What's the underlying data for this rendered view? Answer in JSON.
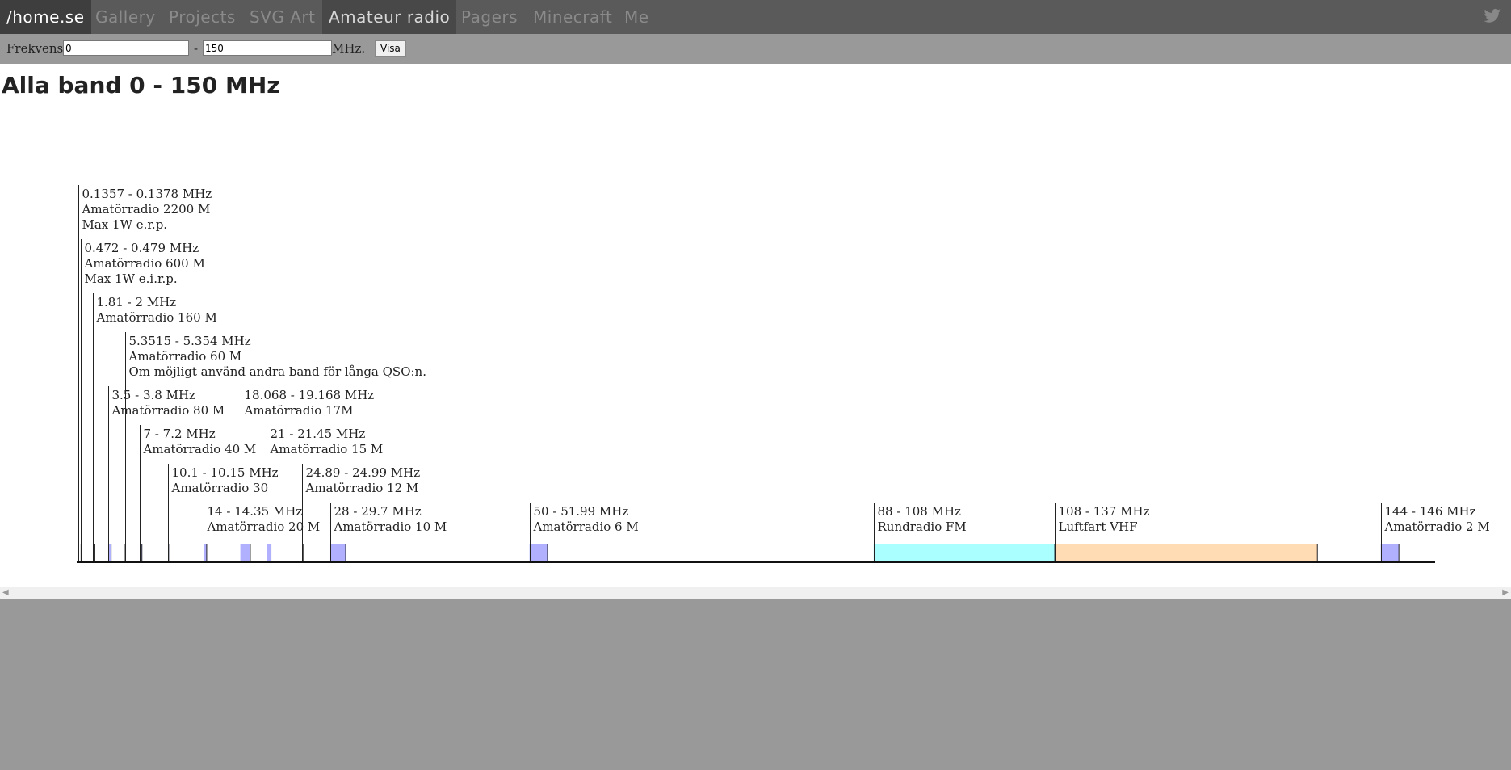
{
  "nav": {
    "home": "/home.se",
    "items": [
      "Gallery",
      "Projects",
      "SVG Art",
      "Amateur radio",
      "Pagers",
      "Minecraft",
      "Me"
    ],
    "active": "Amateur radio",
    "twitter_icon": "twitter-icon"
  },
  "form": {
    "label": "Frekvens:",
    "from_value": "0",
    "dash": "-",
    "to_value": "150",
    "unit": "MHz.",
    "button": "Visa"
  },
  "page": {
    "title": "Alla band 0 - 150 MHz"
  },
  "chart_data": {
    "type": "band-plan",
    "range_mhz": [
      0,
      150
    ],
    "bands": [
      {
        "start": 0.1357,
        "end": 0.1378,
        "lines": [
          "0.1357 - 0.1378 MHz",
          "Amatörradio 2200 M",
          "Max 1W e.r.p."
        ],
        "color": "#b0b0ff"
      },
      {
        "start": 0.472,
        "end": 0.479,
        "lines": [
          "0.472 - 0.479 MHz",
          "Amatörradio 600 M",
          "Max 1W e.i.r.p."
        ],
        "color": "#b0b0ff"
      },
      {
        "start": 1.81,
        "end": 2,
        "lines": [
          "1.81 - 2 MHz",
          "Amatörradio 160 M"
        ],
        "color": "#b0b0ff"
      },
      {
        "start": 3.5,
        "end": 3.8,
        "lines": [
          "3.5 - 3.8 MHz",
          "Amatörradio 80 M"
        ],
        "color": "#b0b0ff"
      },
      {
        "start": 5.3515,
        "end": 5.354,
        "lines": [
          "5.3515 - 5.354 MHz",
          "Amatörradio 60 M",
          "Om möjligt använd andra band för långa QSO:n."
        ],
        "color": "#b0b0ff"
      },
      {
        "start": 7,
        "end": 7.2,
        "lines": [
          "7 - 7.2 MHz",
          "Amatörradio 40 M"
        ],
        "color": "#b0b0ff"
      },
      {
        "start": 10.1,
        "end": 10.15,
        "lines": [
          "10.1 - 10.15 MHz",
          "Amatörradio 30"
        ],
        "color": "#b0b0ff"
      },
      {
        "start": 14,
        "end": 14.35,
        "lines": [
          "14 - 14.35 MHz",
          "Amatörradio 20 M"
        ],
        "color": "#b0b0ff"
      },
      {
        "start": 18.068,
        "end": 19.168,
        "lines": [
          "18.068 - 19.168 MHz",
          "Amatörradio 17M"
        ],
        "color": "#b0b0ff"
      },
      {
        "start": 21,
        "end": 21.45,
        "lines": [
          "21 - 21.45 MHz",
          "Amatörradio 15 M"
        ],
        "color": "#b0b0ff"
      },
      {
        "start": 24.89,
        "end": 24.99,
        "lines": [
          "24.89 - 24.99 MHz",
          "Amatörradio 12 M"
        ],
        "color": "#b0b0ff"
      },
      {
        "start": 28,
        "end": 29.7,
        "lines": [
          "28 - 29.7 MHz",
          "Amatörradio 10 M"
        ],
        "color": "#b0b0ff"
      },
      {
        "start": 50,
        "end": 51.99,
        "lines": [
          "50 - 51.99 MHz",
          "Amatörradio 6 M"
        ],
        "color": "#b0b0ff"
      },
      {
        "start": 88,
        "end": 108,
        "lines": [
          "88 - 108 MHz",
          "Rundradio FM"
        ],
        "color": "#aaffff"
      },
      {
        "start": 108,
        "end": 137,
        "lines": [
          "108 - 137 MHz",
          "Luftfart VHF"
        ],
        "color": "#ffdcb4"
      },
      {
        "start": 144,
        "end": 146,
        "lines": [
          "144 - 146 MHz",
          "Amatörradio 2 M"
        ],
        "color": "#b0b0ff"
      }
    ]
  }
}
